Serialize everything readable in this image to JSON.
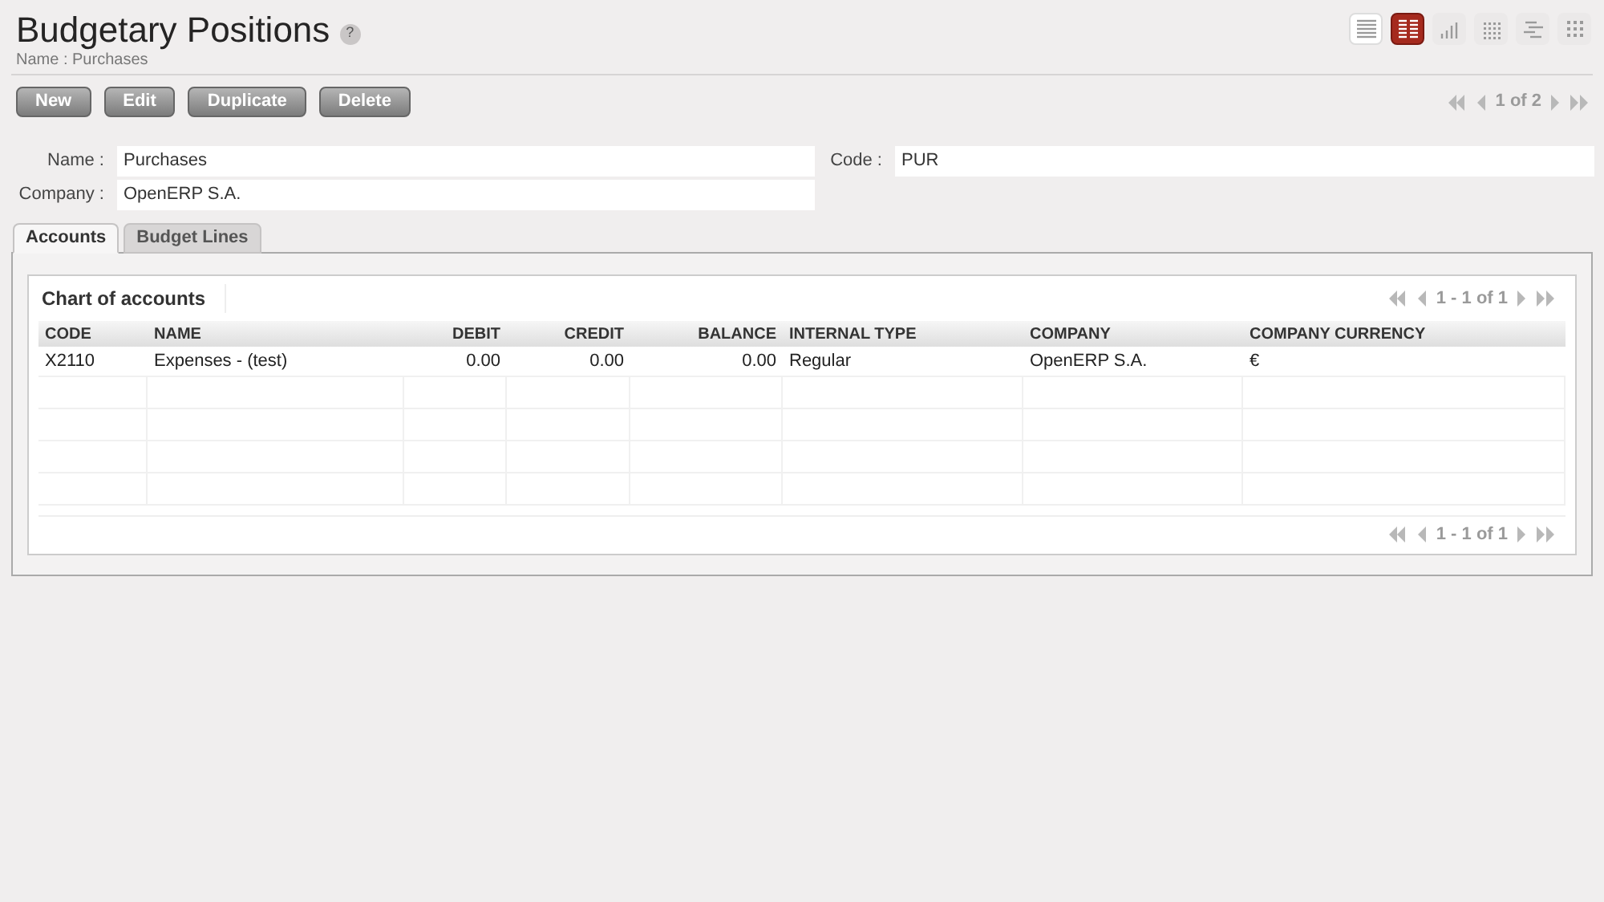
{
  "header": {
    "title": "Budgetary Positions",
    "help": "?",
    "breadcrumb": "Name : Purchases"
  },
  "views": [
    {
      "kind": "list",
      "selected": false
    },
    {
      "kind": "form",
      "selected": true
    },
    {
      "kind": "graph",
      "selected": false
    },
    {
      "kind": "calendar",
      "selected": false
    },
    {
      "kind": "gantt",
      "selected": false
    },
    {
      "kind": "kanban",
      "selected": false
    }
  ],
  "buttons": [
    "New",
    "Edit",
    "Duplicate",
    "Delete"
  ],
  "record_pager": "1 of 2",
  "fields": [
    {
      "label": "Name :",
      "value": "Purchases"
    },
    {
      "label": "Code :",
      "value": "PUR"
    },
    {
      "label": "Company :",
      "value": "OpenERP S.A."
    }
  ],
  "tabs": [
    {
      "label": "Accounts",
      "selected": true
    },
    {
      "label": "Budget Lines",
      "selected": false
    }
  ],
  "table": {
    "title": "Chart of accounts",
    "pager_top": "1 - 1 of 1",
    "pager_bottom": "1 - 1 of 1",
    "columns": [
      {
        "label": "CODE",
        "kind": "text"
      },
      {
        "label": "NAME",
        "kind": "text"
      },
      {
        "label": "DEBIT",
        "kind": "number"
      },
      {
        "label": "CREDIT",
        "kind": "number"
      },
      {
        "label": "BALANCE",
        "kind": "number"
      },
      {
        "label": "INTERNAL TYPE",
        "kind": "text"
      },
      {
        "label": "COMPANY",
        "kind": "text"
      },
      {
        "label": "COMPANY CURRENCY",
        "kind": "text"
      }
    ],
    "rows": [
      [
        "X2110",
        "Expenses - (test)",
        "0.00",
        "0.00",
        "0.00",
        "Regular",
        "OpenERP S.A.",
        "€"
      ]
    ]
  }
}
